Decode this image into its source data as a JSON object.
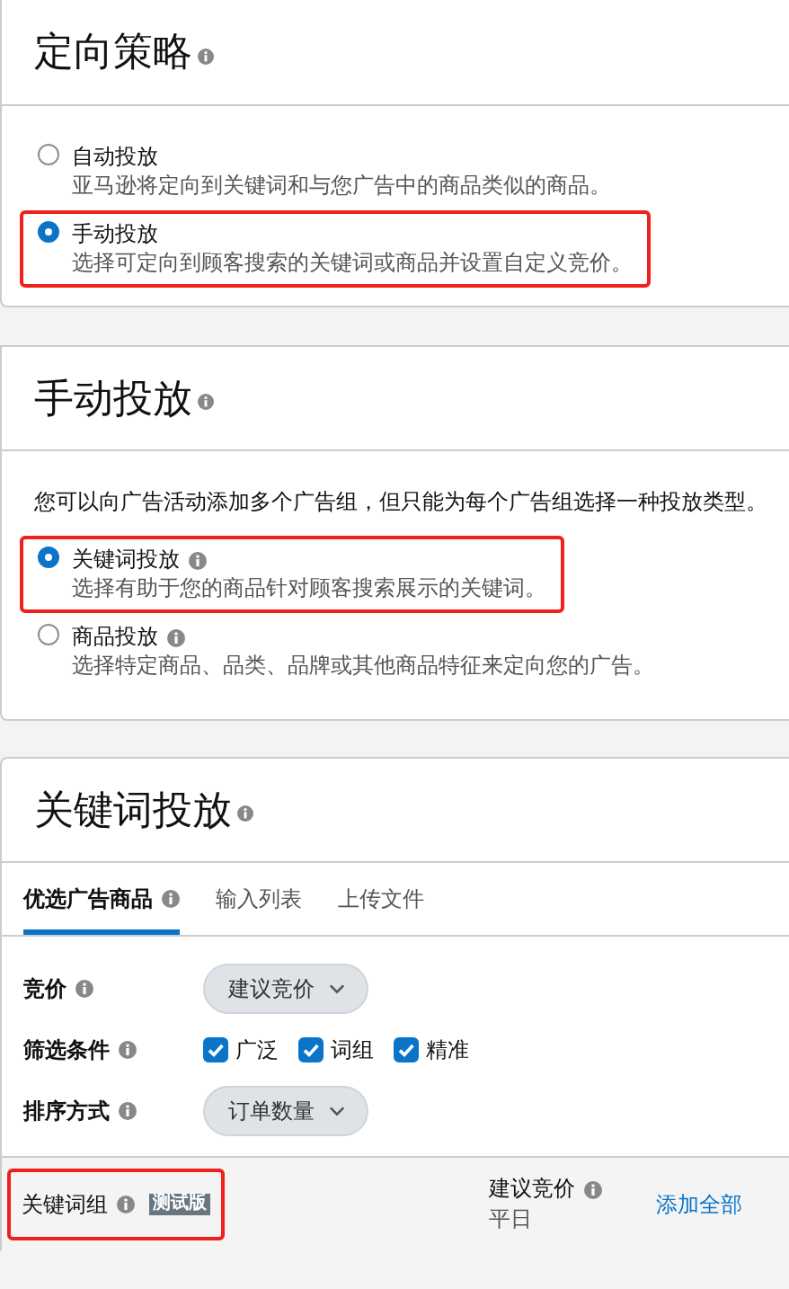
{
  "targeting_strategy": {
    "title": "定向策略",
    "options": [
      {
        "label": "自动投放",
        "description": "亚马逊将定向到关键词和与您广告中的商品类似的商品。",
        "selected": false,
        "highlighted": false,
        "info": false
      },
      {
        "label": "手动投放",
        "description": "选择可定向到顾客搜索的关键词或商品并设置自定义竞价。",
        "selected": true,
        "highlighted": true,
        "info": false
      }
    ]
  },
  "manual_targeting": {
    "title": "手动投放",
    "description": "您可以向广告活动添加多个广告组，但只能为每个广告组选择一种投放类型。",
    "options": [
      {
        "label": "关键词投放",
        "description": "选择有助于您的商品针对顾客搜索展示的关键词。",
        "selected": true,
        "highlighted": true,
        "info": true
      },
      {
        "label": "商品投放",
        "description": "选择特定商品、品类、品牌或其他商品特征来定向您的广告。",
        "selected": false,
        "highlighted": false,
        "info": true
      }
    ]
  },
  "keyword_targeting": {
    "title": "关键词投放",
    "tabs": [
      {
        "label": "优选广告商品",
        "selected": true,
        "info": true
      },
      {
        "label": "输入列表",
        "selected": false,
        "info": false
      },
      {
        "label": "上传文件",
        "selected": false,
        "info": false
      }
    ],
    "settings": [
      {
        "kind": "dropdown",
        "label": "竞价",
        "value": "建议竞价"
      },
      {
        "kind": "checkboxes",
        "label": "筛选条件",
        "options": [
          {
            "label": "广泛",
            "checked": true
          },
          {
            "label": "词组",
            "checked": true
          },
          {
            "label": "精准",
            "checked": true
          }
        ]
      },
      {
        "kind": "dropdown",
        "label": "排序方式",
        "value": "订单数量"
      }
    ],
    "table_header": {
      "column_1": "关键词组",
      "badge": "测试版",
      "highlighted": true,
      "column_2": "建议竞价",
      "column_2_sub": "平日",
      "action": "添加全部"
    }
  }
}
